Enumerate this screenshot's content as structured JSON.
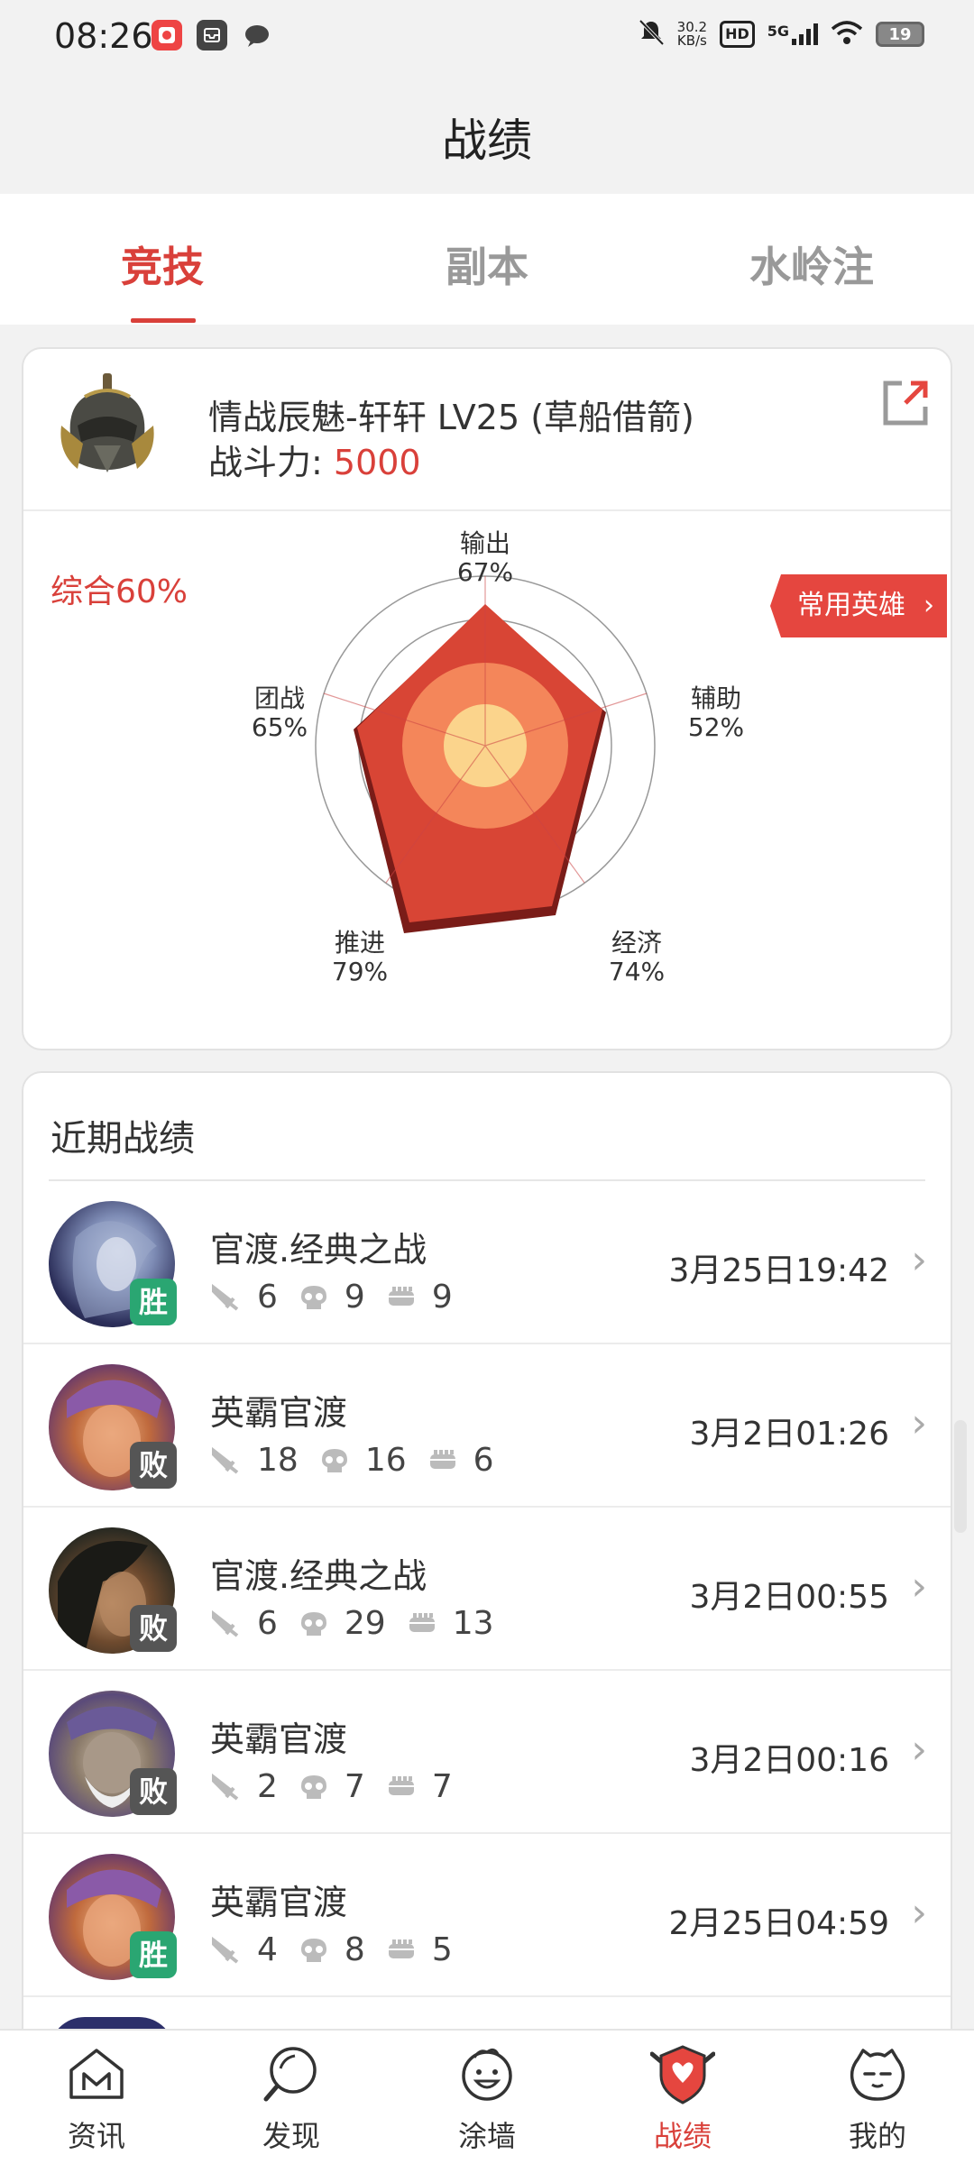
{
  "status_bar": {
    "time": "08:26",
    "net_speed_value": "30.2",
    "net_speed_unit": "KB/s",
    "hd": "HD",
    "network": "5G",
    "battery": "19"
  },
  "header": {
    "title": "战绩"
  },
  "tabs": [
    {
      "label": "竞技",
      "active": true
    },
    {
      "label": "副本",
      "active": false
    },
    {
      "label": "水岭注",
      "active": false
    }
  ],
  "profile": {
    "name": "情战辰魅-轩轩 LV25 (草船借箭)",
    "power_label": "战斗力: ",
    "power_value": "5000",
    "overall": "综合60%",
    "fav_heroes_label": "常用英雄",
    "accent_color": "#d9403a"
  },
  "radar_stats": [
    {
      "name": "输出",
      "value": "67%"
    },
    {
      "name": "辅助",
      "value": "52%"
    },
    {
      "name": "经济",
      "value": "74%"
    },
    {
      "name": "推进",
      "value": "79%"
    },
    {
      "name": "团战",
      "value": "65%"
    }
  ],
  "recent": {
    "title": "近期战绩",
    "matches": [
      {
        "mode": "官渡.经典之战",
        "result": "胜",
        "kills": "6",
        "deaths": "9",
        "assists": "9",
        "time": "3月25日19:42"
      },
      {
        "mode": "英霸官渡",
        "result": "败",
        "kills": "18",
        "deaths": "16",
        "assists": "6",
        "time": "3月2日01:26"
      },
      {
        "mode": "官渡.经典之战",
        "result": "败",
        "kills": "6",
        "deaths": "29",
        "assists": "13",
        "time": "3月2日00:55"
      },
      {
        "mode": "英霸官渡",
        "result": "败",
        "kills": "2",
        "deaths": "7",
        "assists": "7",
        "time": "3月2日00:16"
      },
      {
        "mode": "英霸官渡",
        "result": "胜",
        "kills": "4",
        "deaths": "8",
        "assists": "5",
        "time": "2月25日04:59"
      }
    ]
  },
  "bottom_nav": [
    {
      "label": "资讯",
      "icon": "news-icon"
    },
    {
      "label": "发现",
      "icon": "discover-icon"
    },
    {
      "label": "涂墙",
      "icon": "graffiti-icon"
    },
    {
      "label": "战绩",
      "icon": "record-shield-icon",
      "active": true
    },
    {
      "label": "我的",
      "icon": "profile-icon"
    }
  ]
}
